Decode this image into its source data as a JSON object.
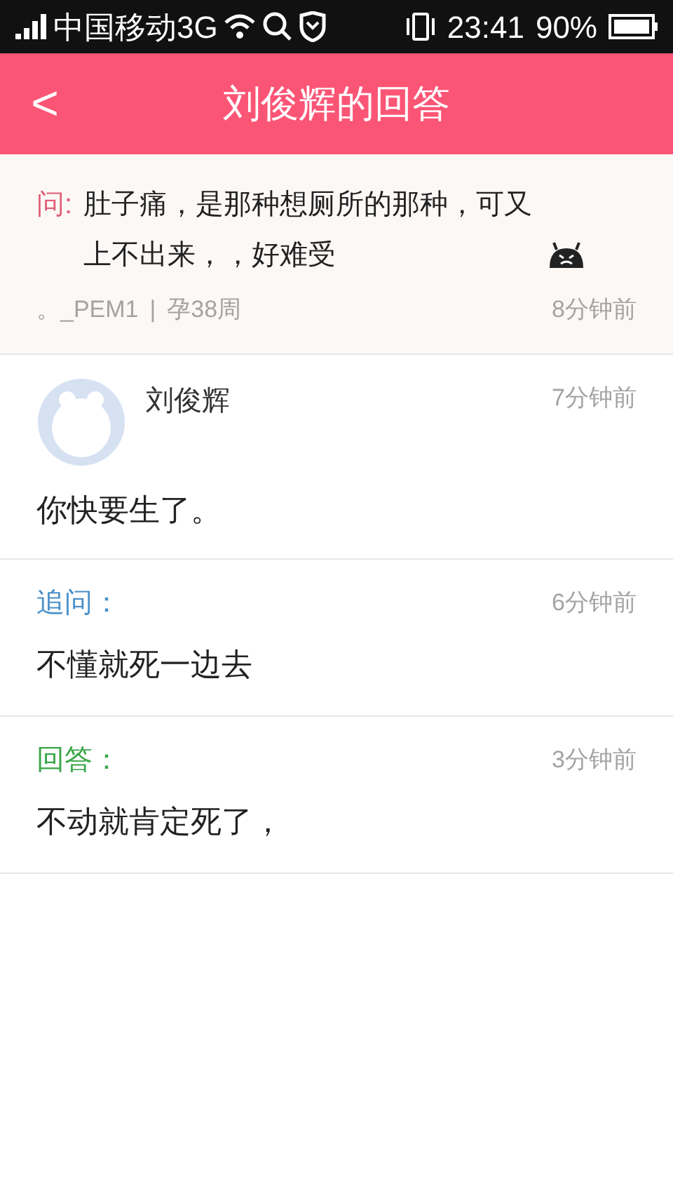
{
  "status_bar": {
    "carrier": "中国移动3G",
    "time": "23:41",
    "battery": "90%"
  },
  "header": {
    "back": "<",
    "title": "刘俊辉的回答"
  },
  "question": {
    "label": "问:",
    "text": "肚子痛，是那种想厕所的那种，可又上不出来，，好难受",
    "asker": "。_PEM1",
    "separator": "|",
    "week": "孕38周",
    "time": "8分钟前"
  },
  "answer": {
    "name": "刘俊辉",
    "time": "7分钟前",
    "text": "你快要生了。"
  },
  "thread": [
    {
      "label": "追问：",
      "color": "#4a90c8",
      "time": "6分钟前",
      "text": "不懂就死一边去"
    },
    {
      "label": "回答：",
      "color": "#3aa548",
      "time": "3分钟前",
      "text": "不动就肯定死了，"
    }
  ]
}
